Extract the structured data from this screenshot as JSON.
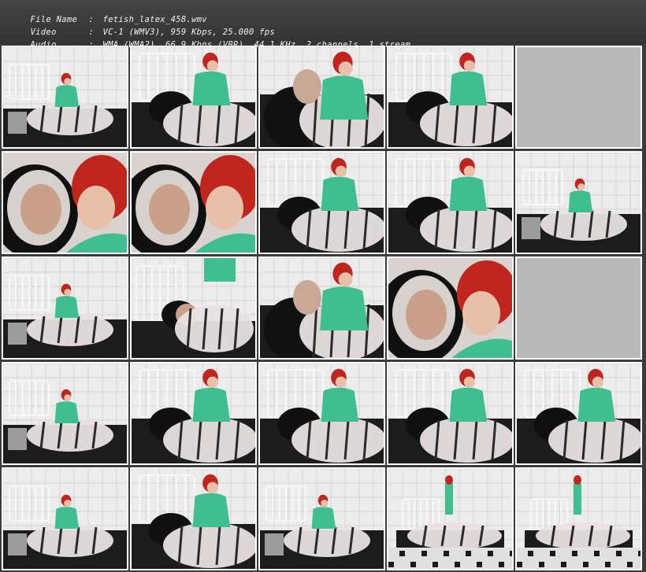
{
  "header": {
    "rows": [
      {
        "label": "File Name",
        "value": "fetish_latex_458.wmv"
      },
      {
        "label": "Video",
        "value": "VC-1 (WMV3), 959 Kbps, 25.000 fps"
      },
      {
        "label": "Audio",
        "value": "WMA (WMA2), 66.9 Kbps (VBR), 44.1 KHz, 2 channels, 1 stream"
      }
    ]
  },
  "grid": {
    "columns": 5,
    "rows": 5,
    "thumbnails": [
      {
        "scene": "wide"
      },
      {
        "scene": "mid"
      },
      {
        "scene": "close"
      },
      {
        "scene": "mid"
      },
      {
        "scene": "blank"
      },
      {
        "scene": "face"
      },
      {
        "scene": "face"
      },
      {
        "scene": "mid"
      },
      {
        "scene": "mid"
      },
      {
        "scene": "wide"
      },
      {
        "scene": "wide"
      },
      {
        "scene": "bed"
      },
      {
        "scene": "close"
      },
      {
        "scene": "face"
      },
      {
        "scene": "blank"
      },
      {
        "scene": "wide"
      },
      {
        "scene": "mid"
      },
      {
        "scene": "mid"
      },
      {
        "scene": "mid"
      },
      {
        "scene": "mid"
      },
      {
        "scene": "wide"
      },
      {
        "scene": "mid"
      },
      {
        "scene": "wide"
      },
      {
        "scene": "room"
      },
      {
        "scene": "room"
      }
    ]
  },
  "colors": {
    "background": "#3b3b3b",
    "header_text": "#f2f2f2",
    "frame": "#ffffff",
    "blank_frame": "#b9b9b9",
    "scrubs": "#3fbf8f",
    "hair": "#c0261e",
    "bedding": "#1c1c1c",
    "plastic": "#e9e2e2",
    "wall": "#ececec"
  }
}
